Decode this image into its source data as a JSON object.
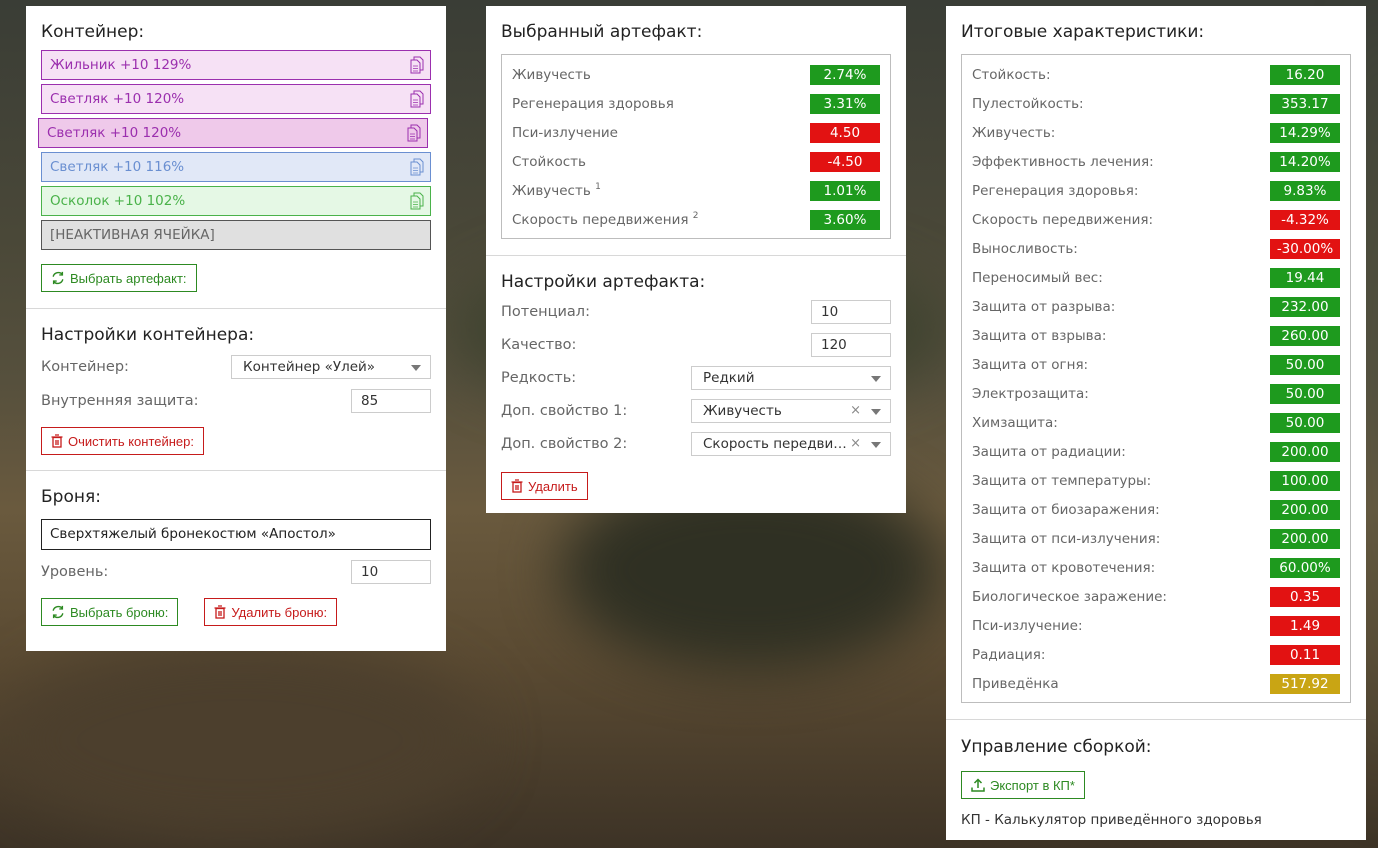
{
  "colors": {
    "positive": "#1e9a1e",
    "negative": "#e21212",
    "summary": "#c9a514",
    "green": "#2d8a22",
    "red": "#c61b1b"
  },
  "container_panel": {
    "title": "Контейнер:",
    "slots": [
      {
        "label": "Жильник +10 129%",
        "icon": "copy-icon",
        "color": "#9b2fae",
        "bg": "#f6e1f5"
      },
      {
        "label": "Светляк +10 120%",
        "icon": "copy-icon",
        "color": "#9b2fae",
        "bg": "#f6e1f5"
      },
      {
        "label": "Светляк +10 120%",
        "icon": "copy-icon",
        "color": "#9b2fae",
        "bg": "#efc9ea"
      },
      {
        "label": "Светляк +10 116%",
        "icon": "copy-icon",
        "color": "#6a8fd1",
        "bg": "#e1e8f7"
      },
      {
        "label": "Осколок +10 102%",
        "icon": "copy-icon",
        "color": "#4ab24a",
        "bg": "#e5f8e5"
      },
      {
        "label": "[НЕАКТИВНАЯ ЯЧЕЙКА]",
        "icon": "",
        "color": "#666666",
        "bg": "#e0e0e0"
      }
    ],
    "select_button": "Выбрать артефакт:"
  },
  "container_settings": {
    "title": "Настройки контейнера:",
    "container_label": "Контейнер:",
    "container_value": "Контейнер «Улей»",
    "protection_label": "Внутренняя защита:",
    "protection_value": "85",
    "clear_button": "Очистить контейнер:"
  },
  "armor": {
    "title": "Броня:",
    "name": "Сверхтяжелый бронекостюм «Апостол»",
    "level_label": "Уровень:",
    "level_value": "10",
    "select_button": "Выбрать броню:",
    "delete_button": "Удалить броню:"
  },
  "selected_artifact": {
    "title": "Выбранный артефакт:",
    "stats": [
      {
        "label": "Живучесть",
        "sup": "",
        "value": "2.74%",
        "type": "positive"
      },
      {
        "label": "Регенерация здоровья",
        "sup": "",
        "value": "3.31%",
        "type": "positive"
      },
      {
        "label": "Пси-излучение",
        "sup": "",
        "value": "4.50",
        "type": "negative"
      },
      {
        "label": "Стойкость",
        "sup": "",
        "value": "-4.50",
        "type": "negative"
      },
      {
        "label": "Живучесть",
        "sup": "1",
        "value": "1.01%",
        "type": "positive"
      },
      {
        "label": "Скорость передвижения",
        "sup": "2",
        "value": "3.60%",
        "type": "positive"
      }
    ]
  },
  "artifact_settings": {
    "title": "Настройки артефакта:",
    "potential_label": "Потенциал:",
    "potential_value": "10",
    "quality_label": "Качество:",
    "quality_value": "120",
    "rarity_label": "Редкость:",
    "rarity_value": "Редкий",
    "prop1_label": "Доп. свойство 1:",
    "prop1_value": "Живучесть",
    "prop2_label": "Доп. свойство 2:",
    "prop2_value": "Скорость передви…",
    "clear_glyph": "×",
    "delete_button": "Удалить"
  },
  "summary": {
    "title": "Итоговые характеристики:",
    "stats": [
      {
        "label": "Стойкость:",
        "value": "16.20",
        "type": "positive"
      },
      {
        "label": "Пулестойкость:",
        "value": "353.17",
        "type": "positive"
      },
      {
        "label": "Живучесть:",
        "value": "14.29%",
        "type": "positive"
      },
      {
        "label": "Эффективность лечения:",
        "value": "14.20%",
        "type": "positive"
      },
      {
        "label": "Регенерация здоровья:",
        "value": "9.83%",
        "type": "positive"
      },
      {
        "label": "Скорость передвижения:",
        "value": "-4.32%",
        "type": "negative"
      },
      {
        "label": "Выносливость:",
        "value": "-30.00%",
        "type": "negative"
      },
      {
        "label": "Переносимый вес:",
        "value": "19.44",
        "type": "positive"
      },
      {
        "label": "Защита от разрыва:",
        "value": "232.00",
        "type": "positive"
      },
      {
        "label": "Защита от взрыва:",
        "value": "260.00",
        "type": "positive"
      },
      {
        "label": "Защита от огня:",
        "value": "50.00",
        "type": "positive"
      },
      {
        "label": "Электрозащита:",
        "value": "50.00",
        "type": "positive"
      },
      {
        "label": "Химзащита:",
        "value": "50.00",
        "type": "positive"
      },
      {
        "label": "Защита от радиации:",
        "value": "200.00",
        "type": "positive"
      },
      {
        "label": "Защита от температуры:",
        "value": "100.00",
        "type": "positive"
      },
      {
        "label": "Защита от биозаражения:",
        "value": "200.00",
        "type": "positive"
      },
      {
        "label": "Защита от пси-излучения:",
        "value": "200.00",
        "type": "positive"
      },
      {
        "label": "Защита от кровотечения:",
        "value": "60.00%",
        "type": "positive"
      },
      {
        "label": "Биологическое заражение:",
        "value": "0.35",
        "type": "negative"
      },
      {
        "label": "Пси-излучение:",
        "value": "1.49",
        "type": "negative"
      },
      {
        "label": "Радиация:",
        "value": "0.11",
        "type": "negative"
      },
      {
        "label": "Приведёнка",
        "value": "517.92",
        "type": "summary"
      }
    ]
  },
  "build": {
    "title": "Управление сборкой:",
    "export_button": "Экспорт в КП*",
    "footnote": "КП - Калькулятор приведённого здоровья"
  }
}
